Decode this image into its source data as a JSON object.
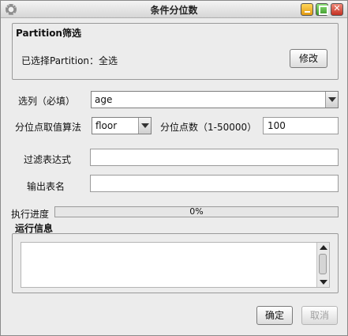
{
  "window": {
    "title": "条件分位数"
  },
  "partition": {
    "group_title": "Partition筛选",
    "selected_text": "已选择Partition：全选",
    "modify_label": "修改"
  },
  "form": {
    "column_label": "选列（必填）",
    "column_value": "age",
    "algorithm_label": "分位点取值算法",
    "algorithm_value": "floor",
    "quantile_count_label": "分位点数（1-50000）",
    "quantile_count_value": "100",
    "filter_label": "过滤表达式",
    "filter_value": "",
    "output_label": "输出表名",
    "output_value": ""
  },
  "progress": {
    "label": "执行进度",
    "percent_text": "0%",
    "fraction": 0
  },
  "run_info": {
    "title": "运行信息",
    "content": ""
  },
  "buttons": {
    "ok_label": "确定",
    "cancel_label": "取消"
  },
  "icons": [
    "gear-icon",
    "minimize-icon",
    "maximize-icon",
    "close-icon",
    "dropdown-arrow-icon",
    "scroll-up-icon",
    "scroll-down-icon"
  ]
}
